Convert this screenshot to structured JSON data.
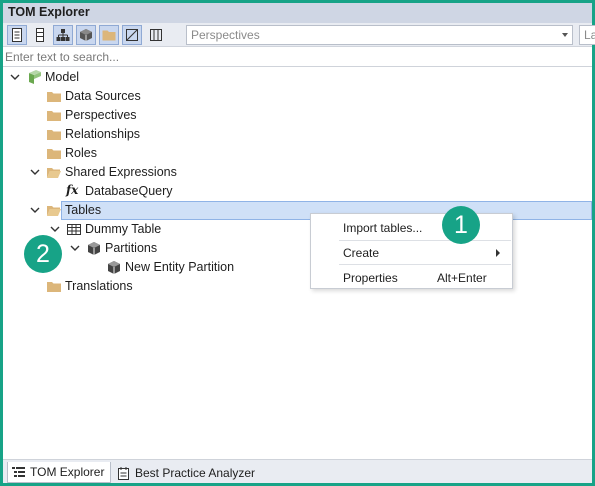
{
  "window": {
    "title": "TOM Explorer"
  },
  "toolbar": {
    "buttons": [
      {
        "icon": "document-icon"
      },
      {
        "icon": "list-icon"
      },
      {
        "icon": "hierarchy-icon"
      },
      {
        "icon": "cube-icon"
      },
      {
        "icon": "folder-icon"
      },
      {
        "icon": "hidden-toggle-icon"
      },
      {
        "icon": "columns-icon"
      }
    ],
    "perspectives_placeholder": "Perspectives",
    "language_placeholder": "La"
  },
  "search": {
    "placeholder": "Enter text to search..."
  },
  "tree": [
    {
      "label": "Model",
      "icon": "model-icon",
      "expanded": true
    },
    {
      "label": "Data Sources",
      "icon": "folder-icon"
    },
    {
      "label": "Perspectives",
      "icon": "folder-icon"
    },
    {
      "label": "Relationships",
      "icon": "folder-icon"
    },
    {
      "label": "Roles",
      "icon": "folder-icon"
    },
    {
      "label": "Shared Expressions",
      "icon": "folder-open-icon",
      "expanded": true
    },
    {
      "label": "DatabaseQuery",
      "icon": "fx-icon"
    },
    {
      "label": "Tables",
      "icon": "folder-open-icon",
      "expanded": true,
      "selected": true
    },
    {
      "label": "Dummy Table",
      "icon": "table-icon",
      "expanded": true
    },
    {
      "label": "Partitions",
      "icon": "partitions-icon",
      "expanded": true
    },
    {
      "label": "New Entity Partition",
      "icon": "partition-icon"
    },
    {
      "label": "Translations",
      "icon": "folder-icon"
    }
  ],
  "context_menu": {
    "items": [
      {
        "label": "Import tables...",
        "shortcut": ""
      },
      {
        "label": "Create",
        "shortcut": "",
        "submenu": true
      },
      {
        "label": "Properties",
        "shortcut": "Alt+Enter"
      }
    ]
  },
  "callouts": {
    "one": "1",
    "two": "2",
    "color": "#17a387"
  },
  "statusbar": {
    "tabs": [
      {
        "label": "TOM Explorer",
        "active": true
      },
      {
        "label": "Best Practice Analyzer",
        "active": false
      }
    ]
  },
  "colors": {
    "accent": "#17a387",
    "selection": "#cfe0f7",
    "folder": "#dcb67a"
  }
}
